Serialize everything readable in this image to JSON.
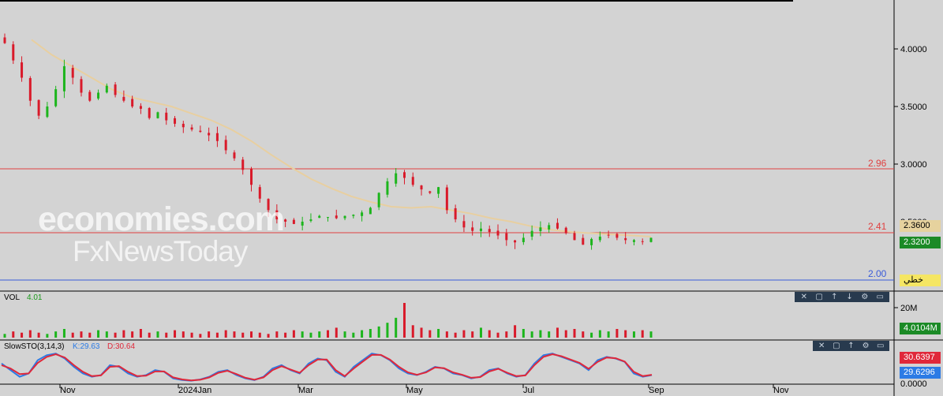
{
  "chart_data": {
    "type": "candlestick",
    "price_axis": {
      "ticks": [
        "4.0000",
        "3.5000",
        "3.0000",
        "2.5000"
      ],
      "ylim": [
        1.9,
        4.35
      ]
    },
    "time_axis": {
      "labels": [
        "Nov",
        "2024Jan",
        "Mar",
        "May",
        "Jul",
        "Sep",
        "Nov"
      ]
    },
    "horizontal_lines": [
      {
        "value": 2.96,
        "label": "2.96",
        "color": "#e04040"
      },
      {
        "value": 2.41,
        "label": "2.41",
        "color": "#e04040"
      },
      {
        "value": 2.0,
        "label": "2.00",
        "color": "#3a5bd9"
      }
    ],
    "price_tags": [
      {
        "value": 2.36,
        "label": "2.3600",
        "bg": "#e6d29e",
        "fg": "#000000"
      },
      {
        "value": 2.32,
        "label": "2.3200",
        "bg": "#1b8a26",
        "fg": "#ffffff"
      }
    ],
    "line_tag": "خطي",
    "candle_colors": {
      "up": "#1cb51c",
      "down": "#d91a2a"
    },
    "moving_average_color": "#e8cfa0",
    "series": [
      {
        "name": "close",
        "values": [
          4.05,
          3.9,
          3.75,
          3.55,
          3.42,
          3.5,
          3.65,
          3.85,
          3.75,
          3.62,
          3.55,
          3.62,
          3.68,
          3.6,
          3.55,
          3.5,
          3.48,
          3.4,
          3.45,
          3.38,
          3.35,
          3.32,
          3.3,
          3.28,
          3.25,
          3.2,
          3.12,
          3.05,
          2.95,
          2.82,
          2.7,
          2.6,
          2.52,
          2.5,
          2.48,
          2.5,
          2.52,
          2.55,
          2.54,
          2.53,
          2.55,
          2.56,
          2.58,
          2.62,
          2.75,
          2.85,
          2.92,
          2.88,
          2.82,
          2.78,
          2.75,
          2.8,
          2.6,
          2.52,
          2.45,
          2.42,
          2.44,
          2.41,
          2.38,
          2.34,
          2.32,
          2.36,
          2.42,
          2.45,
          2.47,
          2.44,
          2.4,
          2.34,
          2.3,
          2.35,
          2.37,
          2.38,
          2.36,
          2.34,
          2.34,
          2.33,
          2.36
        ]
      }
    ],
    "moving_average": {
      "name": "MA",
      "values": [
        4.08,
        3.95,
        3.85,
        3.75,
        3.65,
        3.58,
        3.54,
        3.5,
        3.44,
        3.38,
        3.3,
        3.2,
        3.08,
        2.97,
        2.87,
        2.79,
        2.72,
        2.67,
        2.63,
        2.62,
        2.63,
        2.6,
        2.57,
        2.53,
        2.5,
        2.46,
        2.43,
        2.41,
        2.4,
        2.39,
        2.38,
        2.37
      ]
    },
    "volume": {
      "label": "VOL",
      "value_label": "4.01",
      "axis_label": "20M",
      "tag": "4.0104M",
      "values": [
        3,
        5,
        4,
        6,
        4,
        3,
        5,
        7,
        4,
        5,
        4,
        6,
        5,
        4,
        6,
        5,
        7,
        4,
        5,
        4,
        6,
        5,
        4,
        3,
        5,
        4,
        6,
        5,
        4,
        5,
        4,
        3,
        5,
        4,
        6,
        5,
        4,
        5,
        6,
        8,
        5,
        4,
        6,
        7,
        9,
        12,
        16,
        28,
        10,
        8,
        6,
        7,
        5,
        4,
        6,
        5,
        8,
        6,
        4,
        5,
        10,
        7,
        5,
        6,
        5,
        8,
        6,
        7,
        5,
        4,
        6,
        5,
        7,
        6,
        5,
        6,
        5
      ]
    },
    "stochastic": {
      "label": "SlowSTO(3,14,3)",
      "k_label": "K:29.63",
      "d_label": "D:30.64",
      "k_tag": "30.6397",
      "d_tag": "29.6296",
      "axis_label": "0.0000",
      "k_values": [
        60,
        40,
        20,
        30,
        70,
        85,
        90,
        75,
        50,
        30,
        20,
        25,
        55,
        50,
        30,
        20,
        25,
        40,
        35,
        15,
        10,
        8,
        12,
        20,
        35,
        40,
        25,
        15,
        10,
        20,
        45,
        55,
        40,
        30,
        60,
        75,
        70,
        35,
        20,
        50,
        70,
        90,
        85,
        70,
        45,
        30,
        25,
        35,
        50,
        45,
        30,
        25,
        15,
        20,
        40,
        45,
        30,
        20,
        25,
        60,
        85,
        90,
        80,
        70,
        60,
        40,
        70,
        80,
        75,
        65,
        30,
        20,
        25
      ],
      "d_values": [
        55,
        45,
        28,
        30,
        62,
        80,
        88,
        78,
        55,
        35,
        22,
        24,
        50,
        52,
        35,
        22,
        23,
        36,
        36,
        18,
        12,
        9,
        11,
        18,
        32,
        38,
        28,
        17,
        11,
        18,
        40,
        52,
        42,
        32,
        55,
        72,
        72,
        40,
        22,
        45,
        66,
        86,
        86,
        72,
        50,
        33,
        26,
        33,
        48,
        46,
        33,
        26,
        17,
        19,
        36,
        44,
        32,
        22,
        24,
        55,
        80,
        88,
        82,
        72,
        62,
        44,
        65,
        78,
        76,
        66,
        35,
        22,
        26
      ]
    }
  }
}
